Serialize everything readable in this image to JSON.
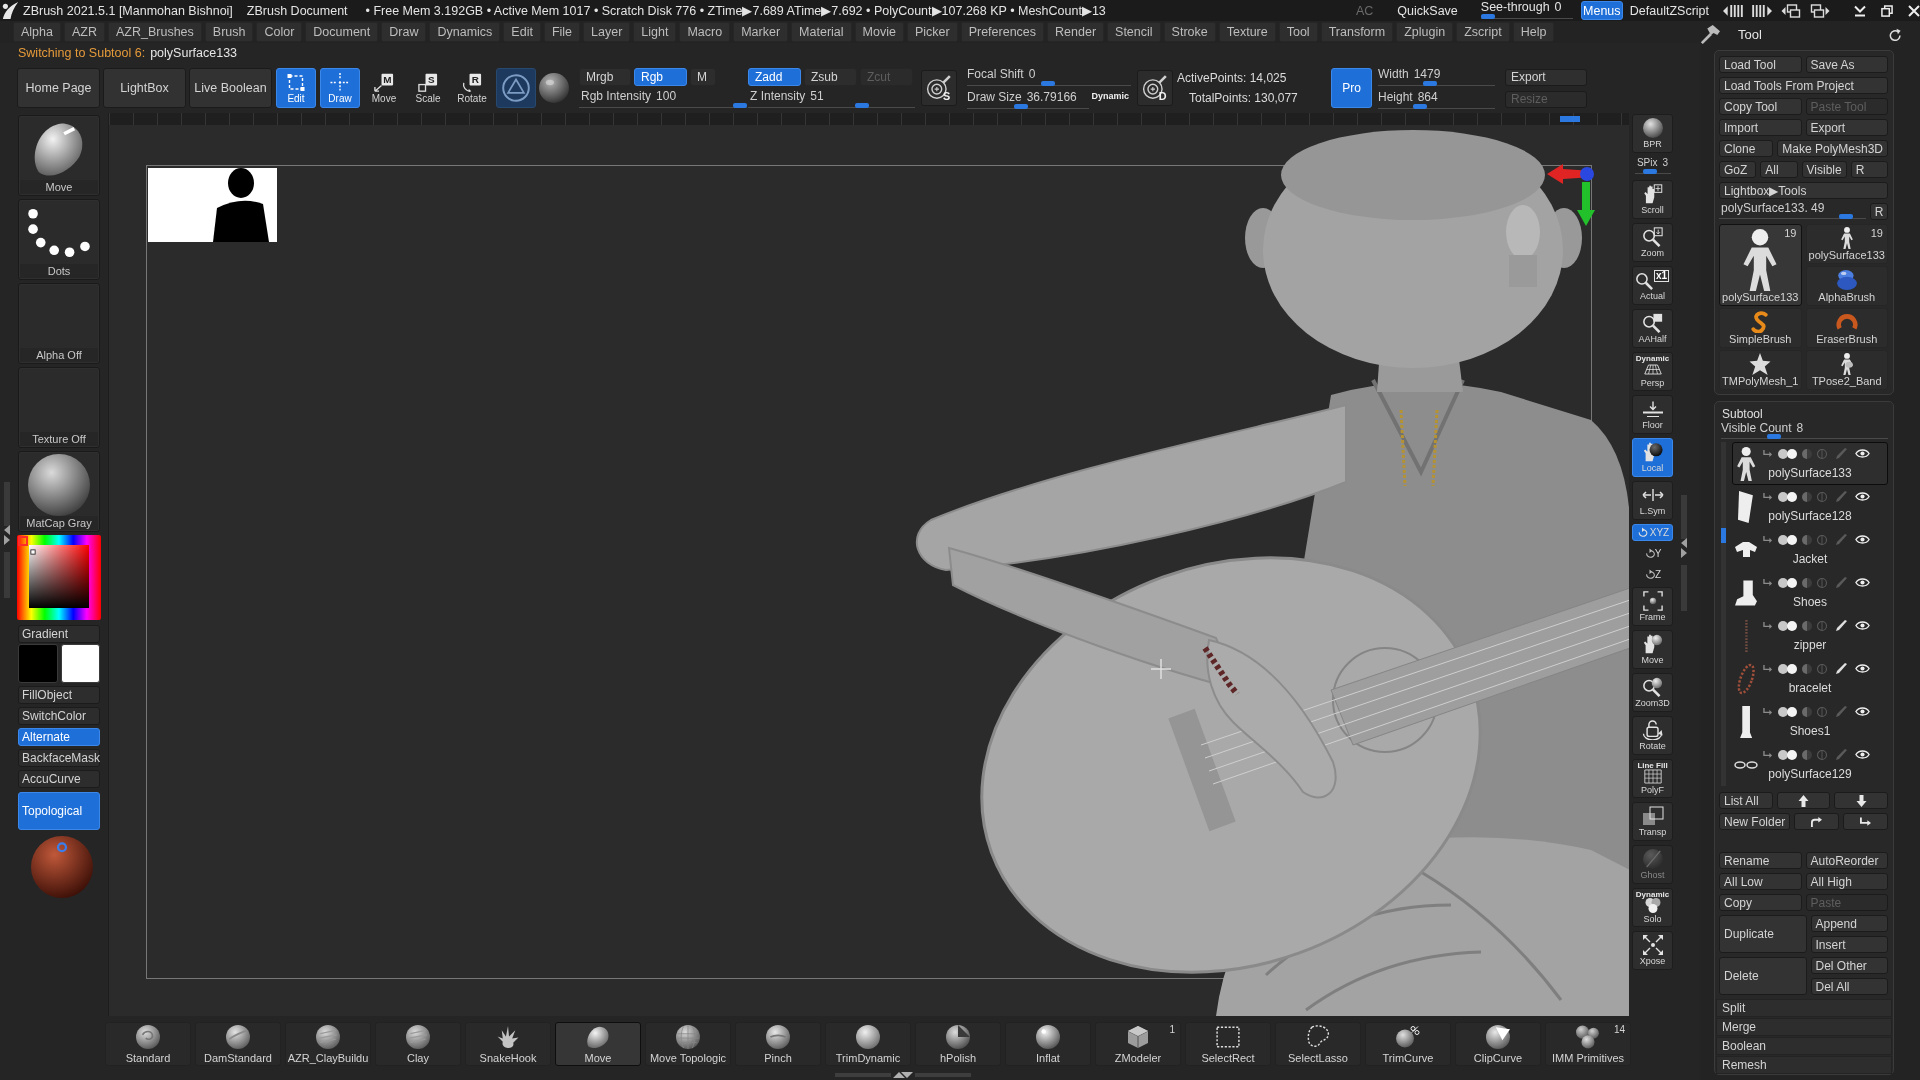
{
  "title_bar": {
    "title": "ZBrush 2021.5.1 [Manmohan Bishnoi]",
    "document": "ZBrush Document",
    "stats": "• Free Mem 3.192GB • Active Mem 1017 • Scratch Disk 776 • ZTime▶7.689 ATime▶7.692 • PolyCount▶107.268 KP • MeshCount▶13",
    "ac": "AC",
    "quicksave": "QuickSave",
    "see_through": {
      "label": "See-through",
      "value": "0",
      "level": 0
    },
    "menus": {
      "label": "Menus",
      "selected": true
    },
    "script": "DefaultZScript"
  },
  "menu_bar": [
    "Alpha",
    "AZR",
    "AZR_Brushes",
    "Brush",
    "Color",
    "Document",
    "Draw",
    "Dynamics",
    "Edit",
    "File",
    "Layer",
    "Light",
    "Macro",
    "Marker",
    "Material",
    "Movie",
    "Picker",
    "Preferences",
    "Render",
    "Stencil",
    "Stroke",
    "Texture",
    "Tool",
    "Transform",
    "Zplugin",
    "Zscript",
    "Help"
  ],
  "notice": {
    "label": "Switching to Subtool 6:",
    "value": "polySurface133"
  },
  "top_shelf": {
    "buttons": [
      "Home Page",
      "LightBox",
      "Live Boolean"
    ],
    "modes": [
      {
        "label": "Edit",
        "kind": "edit",
        "selected": true
      },
      {
        "label": "Draw",
        "kind": "draw",
        "selected": true
      },
      {
        "label": "Move",
        "kind": "move",
        "letter": "M",
        "selected": false
      },
      {
        "label": "Scale",
        "kind": "scale",
        "letter": "S",
        "selected": false
      },
      {
        "label": "Rotate",
        "kind": "rotate",
        "letter": "R",
        "selected": false
      }
    ],
    "ring_toggle": {
      "selected": true
    },
    "color_modes": [
      {
        "label": "Mrgb",
        "selected": false
      },
      {
        "label": "Rgb",
        "selected": true
      },
      {
        "label": "M",
        "selected": false
      }
    ],
    "rgb_intensity": {
      "label": "Rgb Intensity",
      "value": "100",
      "level": 1
    },
    "z_modes": [
      {
        "label": "Zadd",
        "selected": true,
        "disabled": false
      },
      {
        "label": "Zsub",
        "selected": false,
        "disabled": false
      },
      {
        "label": "Zcut",
        "selected": false,
        "disabled": true
      }
    ],
    "z_intensity": {
      "label": "Z Intensity",
      "value": "51",
      "level": 0.7
    },
    "focal_letter": "S",
    "focal_shift": {
      "label": "Focal Shift",
      "value": "0",
      "level": 0.49
    },
    "draw_size": {
      "label": "Draw Size",
      "value": "36.79166",
      "level": 0.43
    },
    "dynamic": "Dynamic",
    "draw_size_letter": "D",
    "active_points": "ActivePoints: 14,025",
    "total_points": "TotalPoints: 130,077",
    "pro": {
      "label": "Pro",
      "selected": true
    },
    "width": {
      "label": "Width",
      "value": "1479",
      "level": 0.44
    },
    "height": {
      "label": "Height",
      "value": "864",
      "level": 0.34
    },
    "doc_buttons": [
      {
        "label": "Export",
        "disabled": false
      },
      {
        "label": "Resize",
        "disabled": true
      }
    ]
  },
  "left_tray": {
    "slots": [
      {
        "kind": "brush",
        "label": "Move"
      },
      {
        "kind": "stroke",
        "label": "Dots"
      },
      {
        "kind": "alpha",
        "label": "Alpha Off"
      },
      {
        "kind": "texture",
        "label": "Texture Off"
      },
      {
        "kind": "material",
        "label": "MatCap Gray"
      }
    ],
    "gradient": "Gradient",
    "swatches": [
      {
        "color": "#000000"
      },
      {
        "color": "#ffffff"
      }
    ],
    "toggles": [
      {
        "label": "FillObject",
        "selected": false
      },
      {
        "label": "SwitchColor",
        "selected": false
      },
      {
        "label": "Alternate",
        "selected": true
      },
      {
        "label": "BackfaceMask",
        "selected": false
      },
      {
        "label": "AccuCurve",
        "selected": false
      }
    ],
    "topological": {
      "label": "Topological",
      "selected": true
    }
  },
  "right_shelf": {
    "items": [
      {
        "kind": "bpr",
        "label": "BPR",
        "selected": false,
        "disabled": false
      },
      {
        "kind": "scroll",
        "label": "Scroll",
        "selected": false,
        "disabled": false
      },
      {
        "kind": "zoom",
        "label": "Zoom",
        "selected": false,
        "disabled": false
      },
      {
        "kind": "actual",
        "label": "Actual",
        "icon_text": "x1",
        "selected": false,
        "disabled": false
      },
      {
        "kind": "aahalf",
        "label": "AAHalf",
        "selected": false,
        "disabled": false
      },
      {
        "kind": "persp",
        "label": "Persp",
        "caption": "Dynamic",
        "selected": false,
        "disabled": false
      },
      {
        "kind": "floor",
        "label": "Floor",
        "selected": false,
        "disabled": false
      },
      {
        "kind": "local",
        "label": "Local",
        "selected": true,
        "disabled": false
      },
      {
        "kind": "lsym",
        "label": "L.Sym",
        "selected": false,
        "disabled": false
      },
      {
        "kind": "xyz",
        "label": "XYZ",
        "selected": true,
        "disabled": false
      },
      {
        "kind": "axis",
        "label": "Y",
        "selected": false,
        "disabled": false
      },
      {
        "kind": "axis",
        "label": "Z",
        "selected": false,
        "disabled": false
      },
      {
        "kind": "frame",
        "label": "Frame",
        "selected": false,
        "disabled": false
      },
      {
        "kind": "move",
        "label": "Move",
        "selected": false,
        "disabled": false
      },
      {
        "kind": "zoom3d",
        "label": "Zoom3D",
        "selected": false,
        "disabled": false
      },
      {
        "kind": "rotate",
        "label": "Rotate",
        "selected": false,
        "disabled": false
      },
      {
        "kind": "polyf",
        "label": "PolyF",
        "caption": "Line Fill",
        "selected": false,
        "disabled": false
      },
      {
        "kind": "transp",
        "label": "Transp",
        "selected": false,
        "disabled": false
      },
      {
        "kind": "ghost",
        "label": "Ghost",
        "selected": false,
        "disabled": true
      },
      {
        "kind": "solo",
        "label": "Solo",
        "caption": "Dynamic",
        "selected": false,
        "disabled": false
      },
      {
        "kind": "xpose",
        "label": "Xpose",
        "selected": false,
        "disabled": false
      }
    ],
    "spix": {
      "label": "SPix",
      "value": "3",
      "level": 0.4
    }
  },
  "bottom_shelf": [
    {
      "name": "Standard",
      "kind": "standard",
      "selected": false
    },
    {
      "name": "DamStandard",
      "kind": "dam",
      "selected": false
    },
    {
      "name": "AZR_ClayBuildu",
      "kind": "clay",
      "selected": false
    },
    {
      "name": "Clay",
      "kind": "clay",
      "selected": false
    },
    {
      "name": "SnakeHook",
      "kind": "snakehook",
      "selected": false
    },
    {
      "name": "Move",
      "kind": "move",
      "selected": true
    },
    {
      "name": "Move Topologic",
      "kind": "grid",
      "selected": false
    },
    {
      "name": "Pinch",
      "kind": "pinch",
      "selected": false
    },
    {
      "name": "TrimDynamic",
      "kind": "smooth",
      "selected": false
    },
    {
      "name": "hPolish",
      "kind": "polish",
      "selected": false
    },
    {
      "name": "Inflat",
      "kind": "inflat",
      "selected": false
    },
    {
      "name": "ZModeler",
      "kind": "cube",
      "badge": "1",
      "selected": false
    },
    {
      "name": "SelectRect",
      "kind": "rect",
      "selected": false
    },
    {
      "name": "SelectLasso",
      "kind": "lasso",
      "selected": false
    },
    {
      "name": "TrimCurve",
      "kind": "trim",
      "selected": false
    },
    {
      "name": "ClipCurve",
      "kind": "clip",
      "selected": false
    },
    {
      "name": "IMM Primitives",
      "kind": "imm",
      "badge": "14",
      "selected": false
    }
  ],
  "tool_panel": {
    "title": "Tool",
    "button_rows": [
      [
        {
          "label": "Load Tool",
          "disabled": false
        },
        {
          "label": "Save As",
          "disabled": false
        }
      ],
      [
        {
          "label": "Load Tools From Project",
          "disabled": false
        }
      ],
      [
        {
          "label": "Copy Tool",
          "disabled": false
        },
        {
          "label": "Paste Tool",
          "disabled": true
        }
      ],
      [
        {
          "label": "Import",
          "disabled": false
        },
        {
          "label": "Export",
          "disabled": false
        }
      ],
      [
        {
          "label": "Clone",
          "disabled": false
        },
        {
          "label": "Make PolyMesh3D",
          "disabled": false
        }
      ],
      [
        {
          "label": "GoZ",
          "disabled": false
        },
        {
          "label": "All",
          "disabled": false
        },
        {
          "label": "Visible",
          "disabled": false
        },
        {
          "label": "R",
          "disabled": false
        }
      ],
      [
        {
          "label": "Lightbox▶Tools",
          "disabled": false
        }
      ]
    ],
    "tool_slider": {
      "label": "polySurface133. 49",
      "level": 0.9,
      "reset": "R"
    },
    "tools": [
      {
        "name": "polySurface133",
        "count": "19",
        "kind": "figure",
        "selected": true
      },
      {
        "name": "polySurface133",
        "count": "19",
        "kind": "figure",
        "selected": false
      },
      {
        "name": "AlphaBrush",
        "kind": "alpha",
        "selected": false
      },
      {
        "name": "SimpleBrush",
        "kind": "simple",
        "selected": false
      },
      {
        "name": "EraserBrush",
        "kind": "eraser",
        "selected": false
      },
      {
        "name": "TMPolyMesh_1",
        "kind": "star",
        "selected": false
      },
      {
        "name": "TPose2_Band",
        "kind": "guitarist",
        "selected": false
      }
    ]
  },
  "subtool": {
    "title": "Subtool",
    "visible_count": {
      "label": "Visible Count",
      "value": "8",
      "level": 0.3
    },
    "items": [
      {
        "name": "polySurface133",
        "kind": "figure",
        "selected": true,
        "paint": false,
        "visible": true
      },
      {
        "name": "polySurface128",
        "kind": "sleeve",
        "selected": false,
        "paint": false,
        "visible": true
      },
      {
        "name": "Jacket",
        "kind": "jacket",
        "selected": false,
        "paint": false,
        "visible": true
      },
      {
        "name": "Shoes",
        "kind": "shoe",
        "selected": false,
        "paint": false,
        "visible": true
      },
      {
        "name": "zipper",
        "kind": "zipper",
        "selected": false,
        "paint": true,
        "visible": true
      },
      {
        "name": "bracelet",
        "kind": "bracelet",
        "selected": false,
        "paint": true,
        "visible": true
      },
      {
        "name": "Shoes1",
        "kind": "boot",
        "selected": false,
        "paint": false,
        "visible": true
      },
      {
        "name": "polySurface129",
        "kind": "lenses",
        "selected": false,
        "paint": false,
        "visible": true
      }
    ],
    "list_all": "List All",
    "new_folder": "New Folder",
    "actions": [
      {
        "kind": "pair",
        "buttons": [
          {
            "label": "Rename",
            "disabled": false
          },
          {
            "label": "AutoReorder",
            "disabled": false
          }
        ]
      },
      {
        "kind": "pair",
        "buttons": [
          {
            "label": "All Low",
            "disabled": false
          },
          {
            "label": "All High",
            "disabled": false
          }
        ]
      },
      {
        "kind": "pair",
        "buttons": [
          {
            "label": "Copy",
            "disabled": false
          },
          {
            "label": "Paste",
            "disabled": true
          }
        ]
      },
      {
        "kind": "group",
        "label": "Duplicate",
        "buttons": [
          {
            "label": "Append",
            "disabled": false
          },
          {
            "label": "Insert",
            "disabled": false
          }
        ]
      },
      {
        "kind": "group",
        "label": "Delete",
        "buttons": [
          {
            "label": "Del Other",
            "disabled": false
          },
          {
            "label": "Del All",
            "disabled": false
          }
        ]
      }
    ],
    "sections": [
      "Split",
      "Merge",
      "Boolean",
      "Remesh"
    ]
  }
}
